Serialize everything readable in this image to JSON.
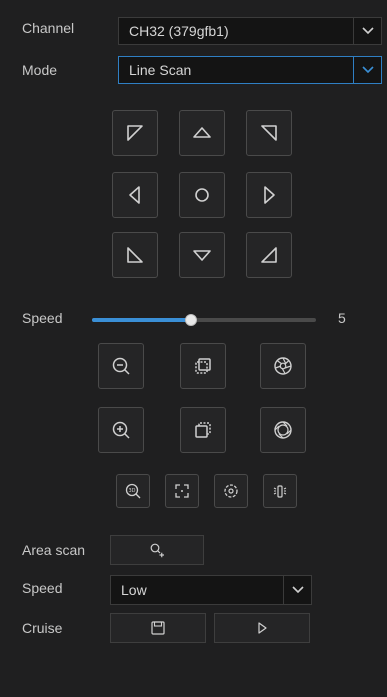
{
  "channel": {
    "label": "Channel",
    "value": "CH32 (379gfb1)"
  },
  "mode": {
    "label": "Mode",
    "value": "Line Scan"
  },
  "speed_slider": {
    "label": "Speed",
    "value": 5,
    "min": 1,
    "max": 8,
    "fraction": 0.44
  },
  "area_scan": {
    "label": "Area scan"
  },
  "speed_select": {
    "label": "Speed",
    "value": "Low"
  },
  "cruise": {
    "label": "Cruise"
  },
  "colors": {
    "accent": "#3a8fd6",
    "background": "#1f1f20",
    "border": "#4a4a4a",
    "icon": "#d0d0d0"
  }
}
